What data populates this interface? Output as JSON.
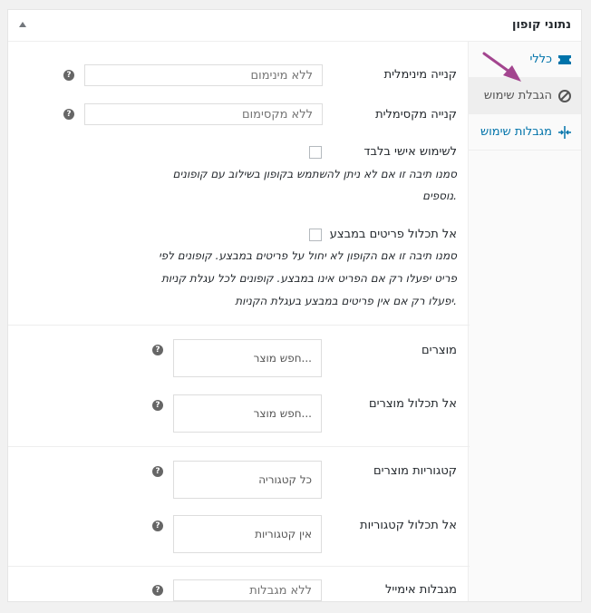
{
  "panel": {
    "title": "נתוני קופון"
  },
  "tabs": [
    {
      "label": "כללי",
      "icon": "ticket-icon"
    },
    {
      "label": "הגבלת שימוש",
      "icon": "block-icon"
    },
    {
      "label": "מגבלות שימוש",
      "icon": "limits-icon"
    }
  ],
  "fields": {
    "min_spend": {
      "label": "קנייה מינימלית",
      "placeholder": "ללא מינימום"
    },
    "max_spend": {
      "label": "קנייה מקסימלית",
      "placeholder": "ללא מקסימום"
    },
    "individual_use": {
      "label": "לשימוש אישי בלבד",
      "desc_line1": "סמנו תיבה זו אם לא ניתן להשתמש בקופון בשילוב עם קופונים",
      "desc_line2": "נוספים."
    },
    "exclude_sale": {
      "label": "אל תכלול פריטים במבצע",
      "desc_line1": "סמנו תיבה זו אם הקופון לא יחול על פריטים במבצע. קופונים לפי",
      "desc_line2": "פריט יפעלו רק אם הפריט אינו במבצע. קופונים לכל עגלת קניות",
      "desc_line3": "יפעלו רק אם אין פריטים במבצע בעגלת הקניות."
    },
    "products": {
      "label": "מוצרים",
      "placeholder": "חפש מוצר..."
    },
    "exclude_products": {
      "label": "אל תכלול מוצרים",
      "placeholder": "חפש מוצר..."
    },
    "categories": {
      "label": "קטגוריות מוצרים",
      "placeholder": "כל קטגוריה"
    },
    "exclude_categories": {
      "label": "אל תכלול קטגוריות",
      "placeholder": "אין קטגוריות"
    },
    "email": {
      "label": "מגבלות אימייל",
      "placeholder": "ללא מגבלות"
    }
  },
  "help_glyph": "?",
  "colors": {
    "link": "#0073aa",
    "arrow": "#a3458f"
  }
}
